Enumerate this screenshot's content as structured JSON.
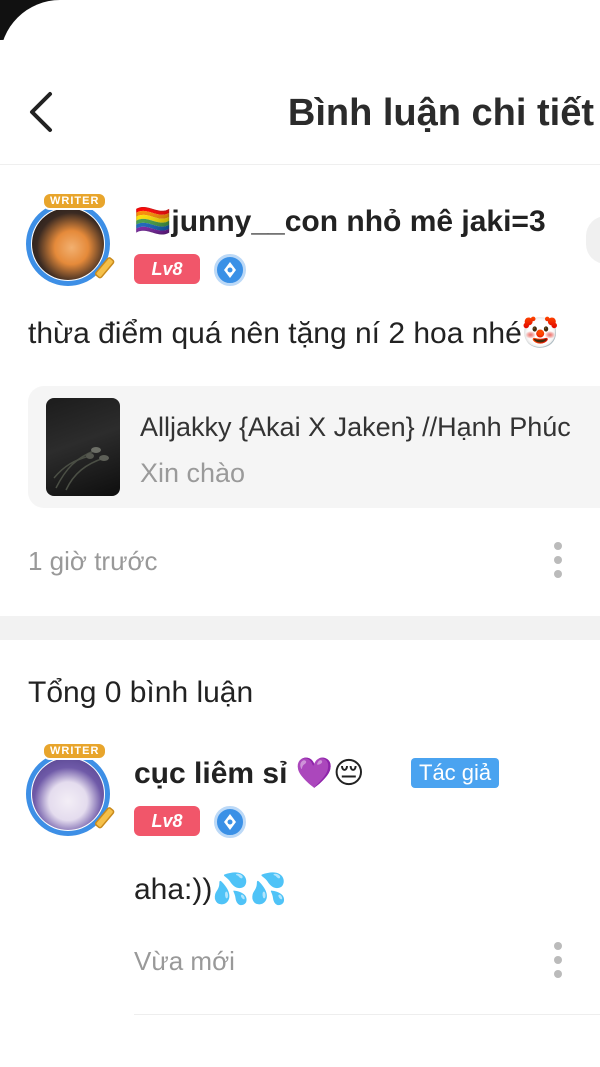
{
  "header": {
    "title": "Bình luận chi tiết",
    "back_icon": "chevron-left-icon"
  },
  "post": {
    "username": "🏳️‍🌈junny__con nhỏ mê jaki=3",
    "level": "Lv8",
    "avatar_badge": "WRITER",
    "content": "thừa điểm quá nên tặng ní 2 hoa nhé🤡",
    "attachment": {
      "title": "Alljakky {Akai X Jaken} //Hạnh Phúc",
      "subtitle": "Xin chào"
    },
    "time": "1 giờ trước"
  },
  "comments_section": {
    "total_label": "Tổng 0 bình luận",
    "comments": [
      {
        "username": "cục liêm sỉ 💜😔",
        "author_tag": "Tác giả",
        "level": "Lv8",
        "avatar_badge": "WRITER",
        "content": "aha:))💦💦",
        "time": "Vừa mới"
      }
    ]
  },
  "colors": {
    "level_badge": "#f1566a",
    "author_tag": "#4aa3f0",
    "avatar_ring": "#3d8fe6"
  }
}
